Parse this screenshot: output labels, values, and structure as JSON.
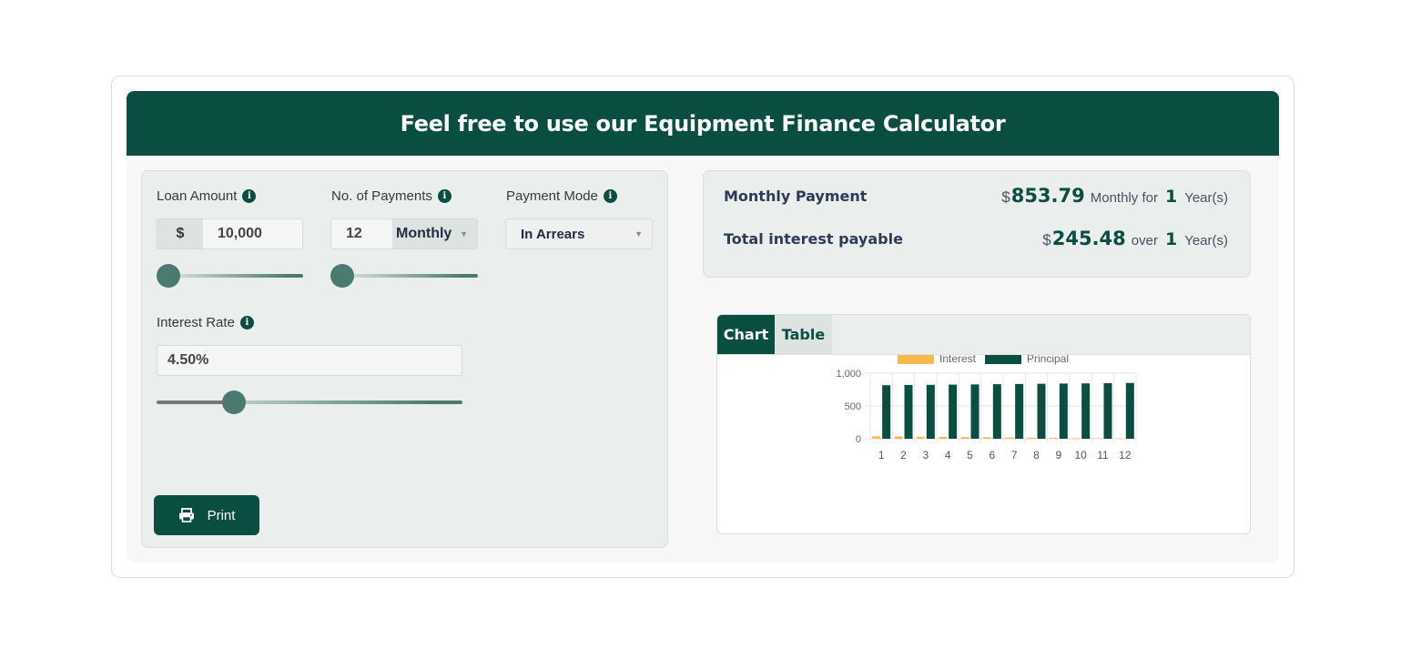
{
  "header": {
    "title": "Feel free to use our Equipment Finance Calculator"
  },
  "loan_amount": {
    "label": "Loan Amount",
    "prefix": "$",
    "value": "10,000",
    "slider_level": 0.0
  },
  "payments": {
    "label": "No. of Payments",
    "value": "12",
    "frequency": "Monthly",
    "slider_level": 0.0
  },
  "payment_mode": {
    "label": "Payment Mode",
    "value": "In Arrears"
  },
  "interest_rate": {
    "label": "Interest Rate",
    "value": "4.50%",
    "slider_level": 0.25
  },
  "print": {
    "label": "Print"
  },
  "summary": {
    "monthly_label": "Monthly Payment",
    "monthly_currency": "$",
    "monthly_amount": "853.79",
    "monthly_text1": "Monthly for",
    "monthly_years": "1",
    "monthly_text2": "Year(s)",
    "interest_label": "Total interest payable",
    "interest_currency": "$",
    "interest_amount": "245.48",
    "interest_text1": "over",
    "interest_years": "1",
    "interest_text2": "Year(s)"
  },
  "tabs": {
    "chart": "Chart",
    "table": "Table"
  },
  "colors": {
    "brand": "#0a4d41",
    "interest": "#f9b84c",
    "principal": "#0a4d41"
  },
  "chart_data": {
    "type": "bar",
    "categories": [
      "1",
      "2",
      "3",
      "4",
      "5",
      "6",
      "7",
      "8",
      "9",
      "10",
      "11",
      "12"
    ],
    "series": [
      {
        "name": "Interest",
        "values": [
          37.5,
          34.4,
          31.3,
          28.1,
          25.0,
          21.9,
          18.8,
          15.6,
          12.5,
          9.4,
          6.3,
          3.1
        ]
      },
      {
        "name": "Principal",
        "values": [
          816.3,
          819.4,
          822.5,
          825.7,
          828.8,
          831.9,
          835.0,
          838.2,
          841.3,
          844.4,
          847.5,
          850.7
        ]
      }
    ],
    "yticks": [
      "0",
      "500",
      "1,000"
    ],
    "ylim": [
      0,
      1000
    ],
    "grid": true,
    "legend": "top"
  }
}
